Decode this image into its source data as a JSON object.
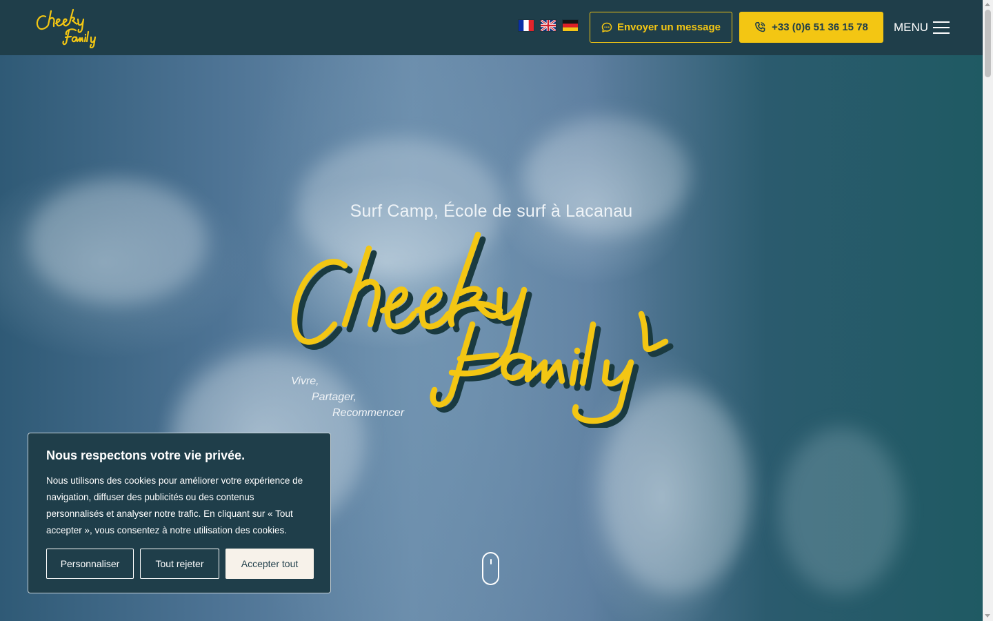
{
  "header": {
    "logo_text": "Cheeky Family",
    "languages": [
      {
        "code": "fr",
        "name": "Français"
      },
      {
        "code": "en",
        "name": "English"
      },
      {
        "code": "de",
        "name": "Deutsch"
      }
    ],
    "message_button": "Envoyer un message",
    "phone_button": "+33 (0)6 51 36 15 78",
    "menu_label": "MENU"
  },
  "hero": {
    "subtitle": "Surf Camp, École de surf à Lacanau",
    "script_title_line1": "Cheeky",
    "script_title_line2": "Family",
    "taglines": [
      "Vivre,",
      "Partager,",
      "Recommencer"
    ]
  },
  "cookie_banner": {
    "title": "Nous respectons votre vie privée.",
    "text": "Nous utilisons des cookies pour améliorer votre expérience de navigation, diffuser des publicités ou des contenus personnalisés et analyser notre trafic. En cliquant sur « Tout accepter », vous consentez à notre utilisation des cookies.",
    "buttons": {
      "customize": "Personnaliser",
      "reject": "Tout rejeter",
      "accept": "Accepter tout"
    }
  },
  "colors": {
    "brand_dark": "#1f3e4a",
    "brand_yellow": "#f3c613",
    "title_shadow": "#1a3a40"
  }
}
